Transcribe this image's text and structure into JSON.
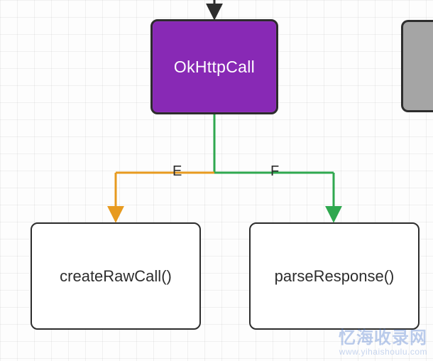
{
  "nodes": {
    "main": {
      "label": "OkHttpCall"
    },
    "left": {
      "label": "createRawCall()"
    },
    "right": {
      "label": "parseResponse()"
    },
    "side": {
      "label": ""
    }
  },
  "edges": {
    "e": {
      "label": "E"
    },
    "f": {
      "label": "F"
    }
  },
  "colors": {
    "main_fill": "#8829b5",
    "border": "#2d2d2d",
    "edge_green": "#2fa84f",
    "edge_orange": "#e79a1f",
    "side_fill": "#a5a5a5"
  },
  "watermark": {
    "line1": "忆海收录网",
    "line2": "www.yihaishoulu.com"
  }
}
